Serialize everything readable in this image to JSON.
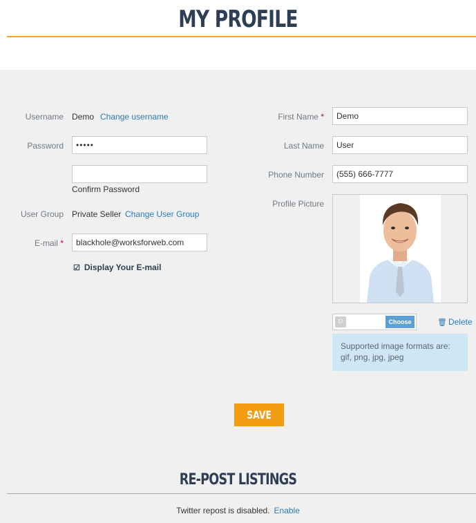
{
  "page": {
    "title": "MY PROFILE"
  },
  "left": {
    "username_label": "Username",
    "username_value": "Demo",
    "change_username": "Change username",
    "password_label": "Password",
    "password_value": "•••••",
    "confirm_password_label": "Confirm Password",
    "user_group_label": "User Group",
    "user_group_value": "Private Seller",
    "change_user_group": "Change User Group",
    "email_label": "E-mail",
    "email_value": "blackhole@worksforweb.com",
    "display_email_label": "Display Your E-mail",
    "display_email_checked": true
  },
  "right": {
    "first_name_label": "First Name",
    "first_name_value": "Demo",
    "last_name_label": "Last Name",
    "last_name_value": "User",
    "phone_label": "Phone Number",
    "phone_value": "(555) 666-7777",
    "profile_picture_label": "Profile Picture",
    "choose_label": "Choose",
    "delete_label": "Delete",
    "formats_note": "Supported image formats are: gif, png, jpg, jpeg"
  },
  "required_marker": "*",
  "save_label": "SAVE",
  "repost": {
    "title": "RE-POST LISTINGS",
    "status": "Twitter repost is disabled.",
    "enable_label": "Enable"
  },
  "icons": {
    "checkbox": "check-square-icon",
    "trash": "trash-icon",
    "file_upload": "upload-icon"
  },
  "colors": {
    "accent_orange": "#f39c12",
    "title_navy": "#2e3f55",
    "link_blue": "#2b7bb9",
    "info_bg": "#cfe6f5",
    "required_red": "#d0021b"
  }
}
